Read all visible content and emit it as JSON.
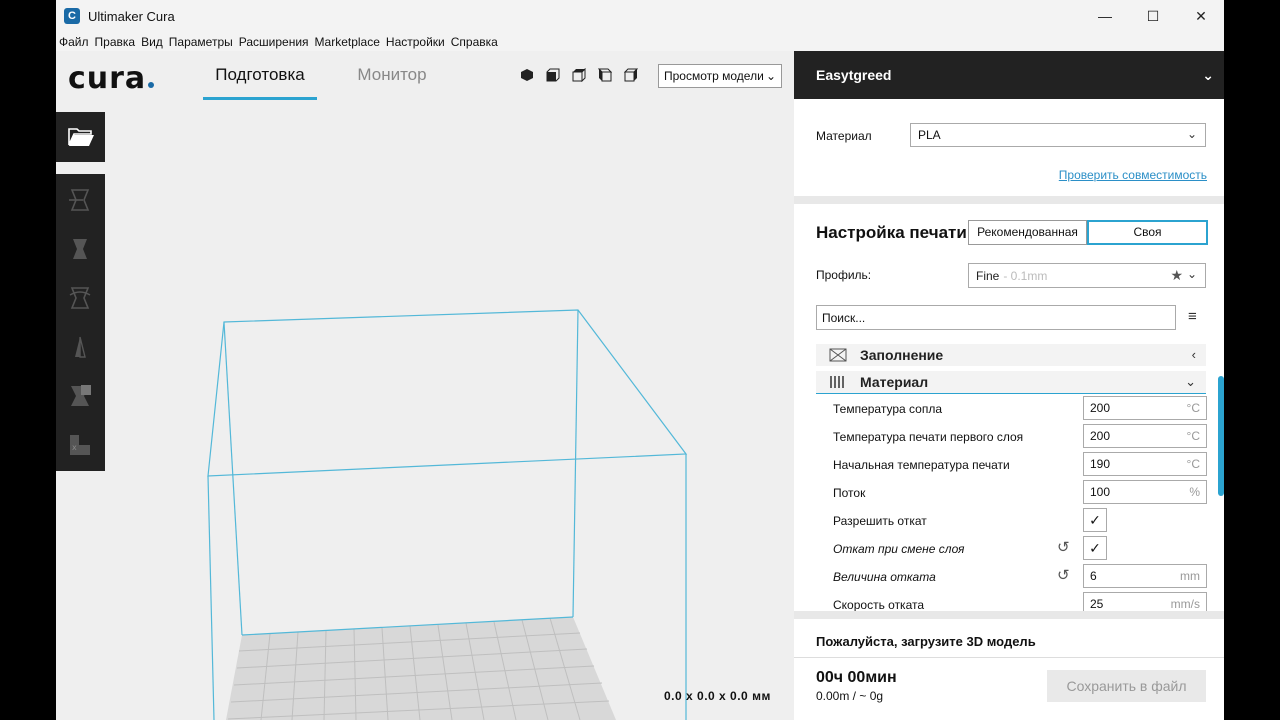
{
  "window": {
    "title": "Ultimaker Cura",
    "app_icon_letter": "C",
    "controls": {
      "minimize": "—",
      "maximize": "☐",
      "close": "✕"
    }
  },
  "menu": [
    "Файл",
    "Правка",
    "Вид",
    "Параметры",
    "Расширения",
    "Marketplace",
    "Настройки",
    "Справка"
  ],
  "header": {
    "logo": "cura",
    "tabs": {
      "prepare": "Подготовка",
      "monitor": "Монитор"
    },
    "view_select": "Просмотр модели"
  },
  "viewport": {
    "dimensions": "0.0 x 0.0 x 0.0 мм",
    "accent": "#2ba3d0"
  },
  "printer": {
    "name": "Easytgreed"
  },
  "material": {
    "label": "Материал",
    "value": "PLA",
    "compat_link": "Проверить совместимость"
  },
  "print_settings": {
    "title": "Настройка печати",
    "modes": {
      "recommended": "Рекомендованная",
      "custom": "Своя"
    },
    "profile_label": "Профиль:",
    "profile_value": "Fine",
    "profile_sub": "- 0.1mm",
    "search_placeholder": "Поиск...",
    "categories": {
      "infill": "Заполнение",
      "material": "Материал"
    },
    "rows": [
      {
        "label": "Температура сопла",
        "value": "200",
        "unit": "°C"
      },
      {
        "label": "Температура печати первого слоя",
        "value": "200",
        "unit": "°C"
      },
      {
        "label": "Начальная температура печати",
        "value": "190",
        "unit": "°C"
      },
      {
        "label": "Поток",
        "value": "100",
        "unit": "%"
      },
      {
        "label": "Разрешить откат",
        "check": "✓"
      },
      {
        "label": "Откат при смене слоя",
        "check": "✓"
      },
      {
        "label": "Величина отката",
        "value": "6",
        "unit": "mm"
      },
      {
        "label": "Скорость отката",
        "value": "25",
        "unit": "mm/s"
      }
    ]
  },
  "footer": {
    "load_message": "Пожалуйста, загрузите 3D модель",
    "time": "00ч 00мин",
    "usage": "0.00m / ~ 0g",
    "save_button": "Сохранить в файл"
  }
}
